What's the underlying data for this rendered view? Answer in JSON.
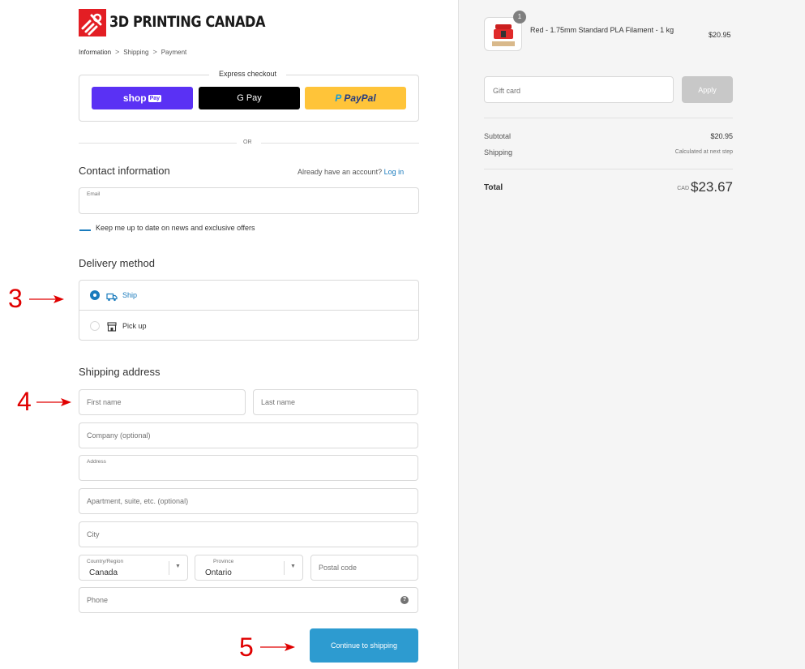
{
  "store": {
    "name": "3D PRINTING CANADA",
    "brand_color": "#e31e24"
  },
  "breadcrumb": {
    "items": [
      "Information",
      "Shipping",
      "Payment"
    ]
  },
  "express_checkout": {
    "title": "Express checkout",
    "shop_pay": {
      "label": "shop",
      "tag": "Pay",
      "color": "#5a31f4"
    },
    "gpay": {
      "label": "G Pay",
      "color": "#000000"
    },
    "paypal": {
      "label": "PayPal",
      "color": "#ffc439"
    },
    "divider_text": "OR"
  },
  "contact": {
    "title": "Contact information",
    "account_prompt": "Already have an account?",
    "login_link": "Log in",
    "email": {
      "label": "Email",
      "value": ""
    },
    "newsletter_label": "Keep me up to date on news and exclusive offers"
  },
  "delivery": {
    "title": "Delivery method",
    "options": [
      {
        "label": "Ship",
        "selected": true,
        "icon": "truck-icon"
      },
      {
        "label": "Pick up",
        "selected": false,
        "icon": "store-icon"
      }
    ]
  },
  "shipping_address": {
    "title": "Shipping address",
    "first_name_placeholder": "First name",
    "last_name_placeholder": "Last name",
    "company_placeholder": "Company (optional)",
    "address_label": "Address",
    "apartment_placeholder": "Apartment, suite, etc. (optional)",
    "city_placeholder": "City",
    "country": {
      "label": "Country/Region",
      "value": "Canada"
    },
    "province": {
      "label": "Province",
      "value": "Ontario"
    },
    "postal_placeholder": "Postal code",
    "phone_placeholder": "Phone"
  },
  "continue_button": "Continue to shipping",
  "annotations": [
    "3",
    "4",
    "5"
  ],
  "annotation_color": "#e00000",
  "accent_color": "#197bbd",
  "order_summary": {
    "product": {
      "name": "Red - 1.75mm Standard PLA Filament - 1 kg",
      "price": "$20.95",
      "quantity": "1"
    },
    "gift_card_placeholder": "Gift card",
    "apply_label": "Apply",
    "subtotal_label": "Subtotal",
    "subtotal_value": "$20.95",
    "shipping_label": "Shipping",
    "shipping_value": "Calculated at next step",
    "total_label": "Total",
    "total_currency": "CAD",
    "total_value": "$23.67"
  }
}
